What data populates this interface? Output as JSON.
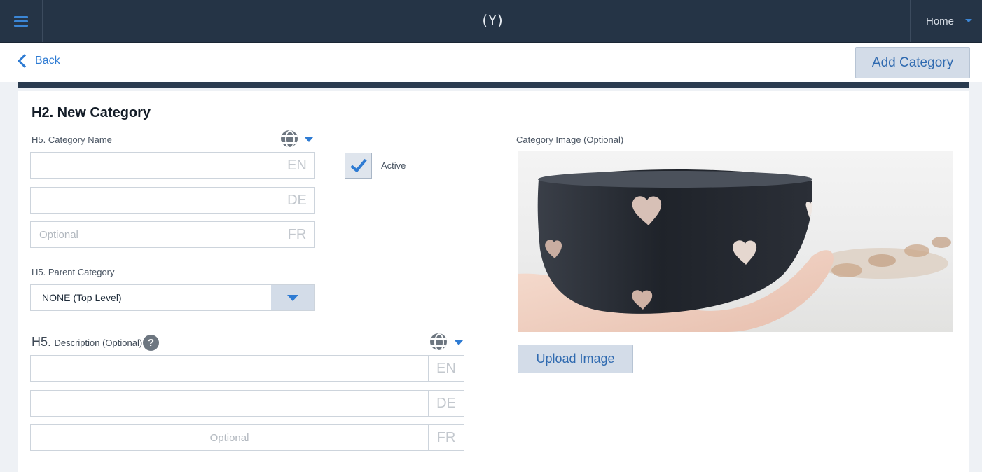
{
  "topbar": {
    "logo_text": "(Y)",
    "home_label": "Home"
  },
  "subbar": {
    "back_label": "Back",
    "add_category_label": "Add Category"
  },
  "form": {
    "title": "H2. New Category",
    "category_name_label": "H5. Category Name",
    "name_fields": [
      {
        "lang": "EN",
        "value": "",
        "placeholder": ""
      },
      {
        "lang": "DE",
        "value": "",
        "placeholder": ""
      },
      {
        "lang": "FR",
        "value": "",
        "placeholder": "Optional"
      }
    ],
    "active_label": "Active",
    "active_checked": true,
    "parent_category_label": "H5. Parent Category",
    "parent_category_value": "NONE (Top Level)",
    "description_label_prefix": "H5.",
    "description_label_text": "Description (Optional)",
    "help_icon_text": "?",
    "description_fields": [
      {
        "lang": "EN",
        "value": "",
        "placeholder": ""
      },
      {
        "lang": "DE",
        "value": "",
        "placeholder": ""
      },
      {
        "lang": "FR",
        "value": "",
        "placeholder": "Optional"
      }
    ]
  },
  "image_panel": {
    "label": "Category Image  (Optional)",
    "upload_label": "Upload Image"
  },
  "icons": {
    "menu": "hamburger-icon",
    "logo": "logo-icon",
    "home_caret": "chevron-down-icon",
    "back": "chevron-left-icon",
    "globe": "globe-icon",
    "help": "help-icon",
    "check": "checkmark-icon"
  },
  "colors": {
    "topbar_bg": "#253446",
    "accent": "#2e7bd3",
    "button_bg": "#d3dce8",
    "button_text": "#2f6ab0"
  }
}
